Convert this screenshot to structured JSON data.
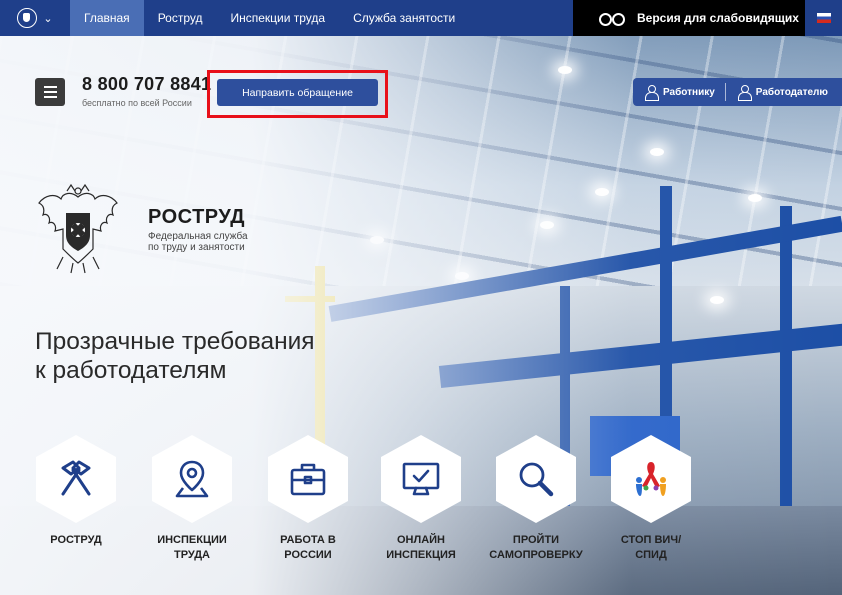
{
  "top_nav": {
    "items": [
      {
        "label": "Главная",
        "active": true
      },
      {
        "label": "Роструд",
        "active": false
      },
      {
        "label": "Инспекции труда",
        "active": false
      },
      {
        "label": "Служба занятости",
        "active": false
      }
    ],
    "vision_label": "Версия для слабовидящих",
    "emblem_icon": "eagle-emblem-icon",
    "language_icon": "russia-flag-icon"
  },
  "header": {
    "phone": "8 800 707 8841",
    "phone_note": "бесплатно по всей России",
    "appeal_button": "Направить обращение",
    "roles": [
      "Работнику",
      "Работодателю"
    ]
  },
  "logo": {
    "title": "РОСТРУД",
    "subtitle_line1": "Федеральная служба",
    "subtitle_line2": "по труду и занятости"
  },
  "headline": {
    "line1": "Прозрачные требования",
    "line2": "к работодателям"
  },
  "tiles": [
    {
      "line1": "РОСТРУД",
      "line2": "",
      "icon": "hammers-icon"
    },
    {
      "line1": "ИНСПЕКЦИИ",
      "line2": "ТРУДА",
      "icon": "map-pin-icon"
    },
    {
      "line1": "РАБОТА В",
      "line2": "РОССИИ",
      "icon": "briefcase-icon"
    },
    {
      "line1": "ОНЛАЙН",
      "line2": "ИНСПЕКЦИЯ",
      "icon": "monitor-check-icon"
    },
    {
      "line1": "ПРОЙТИ",
      "line2": "САМОПРОВЕРКУ",
      "icon": "magnifier-icon"
    },
    {
      "line1": "СТОП ВИЧ/",
      "line2": "СПИД",
      "icon": "hiv-ribbon-icon"
    }
  ],
  "colors": {
    "nav_bg": "#1f3f8a",
    "nav_active": "#4a6eb5",
    "button_bg": "#2e4f9d",
    "highlight": "#e8101a",
    "icon_blue": "#1f3f8a"
  }
}
